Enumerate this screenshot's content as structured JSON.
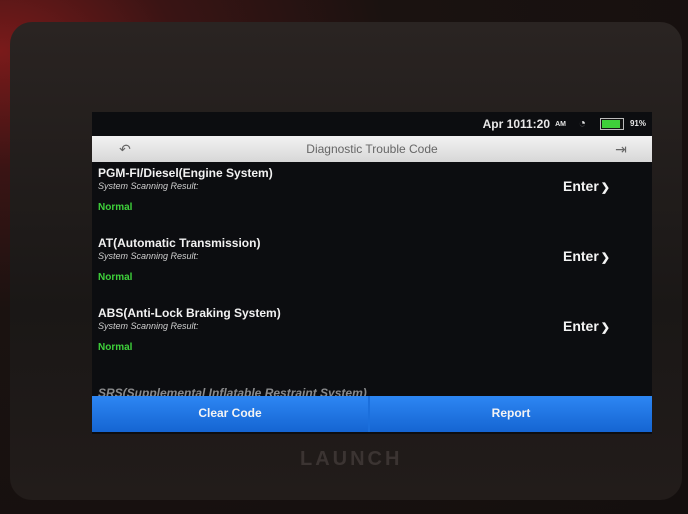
{
  "status_bar": {
    "date": "Apr 10",
    "time": "11:20",
    "ampm": "AM",
    "battery": "91%",
    "battery_fraction": 0.91,
    "wifi_icon": "wifi-icon"
  },
  "header": {
    "title": "Diagnostic Trouble Code",
    "back_icon": "back-icon",
    "exit_icon": "exit-icon"
  },
  "systems": [
    {
      "name": "PGM-FI/Diesel(Engine System)",
      "label": "System Scanning Result:",
      "status": "Normal",
      "action": "Enter"
    },
    {
      "name": "AT(Automatic Transmission)",
      "label": "System Scanning Result:",
      "status": "Normal",
      "action": "Enter"
    },
    {
      "name": "ABS(Anti-Lock Braking System)",
      "label": "System Scanning Result:",
      "status": "Normal",
      "action": "Enter"
    }
  ],
  "partial_item": "SRS(Supplemental Inflatable Restraint System)",
  "footer": {
    "clear_label": "Clear Code",
    "report_label": "Report"
  },
  "brand": "LAUNCH",
  "colors": {
    "accent": "#1b6fdc",
    "normal": "#3ed03a"
  }
}
